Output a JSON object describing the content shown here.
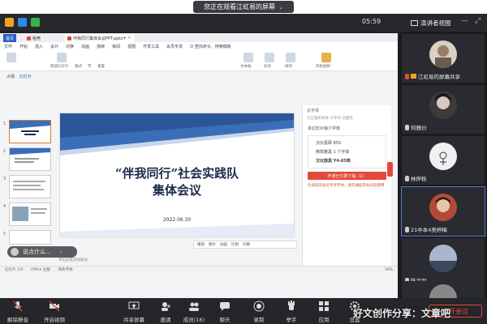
{
  "banner": {
    "viewing_text": "您正在观看江虹易的屏幕"
  },
  "meeting": {
    "time": "05:59",
    "speaker_view": "演讲者视图"
  },
  "wps": {
    "tabs": [
      "首页",
      "稻壳",
      "伴我同行集体会议PPT.pptx"
    ],
    "menus": [
      "文件",
      "开始",
      "插入",
      "设计",
      "切换",
      "动画",
      "放映",
      "审阅",
      "视图",
      "开发工具",
      "会员专享",
      "Q 查找命令、搜索模板"
    ],
    "toolbar_labels": [
      "新建幻灯片",
      "版式",
      "节",
      "重置",
      "文本框",
      "形状",
      "排列",
      "开始放映"
    ],
    "thumb_tabs": [
      "大纲",
      "幻灯片"
    ],
    "status": [
      "幻灯片 1/9",
      "Office 主题",
      "缺失字体"
    ],
    "notes_placeholder": "单击此处添加备注",
    "zoom": "58%",
    "mini_bar": [
      "播放",
      "图片",
      "动画",
      "比例",
      "切换"
    ]
  },
  "slide": {
    "title_line1": "“伴我同行”社会实践队",
    "title_line2": "集体会议",
    "date": "2022.06.30"
  },
  "side_panel": {
    "head": "云字体",
    "sub": "方正粗宋简体 大字体 已推荐",
    "section": "本幻灯片缺少字体",
    "lines": [
      "汉仪嘉颐 85S",
      "微软雅黑 1 个字体",
      "汉仪旗黑 Y4-85简"
    ],
    "button": "开通已付费下载（1）",
    "note": "包含稻壳会员专享字体，请开通稻壳会员后使用"
  },
  "speak_tip": "说点什么...",
  "participants": [
    {
      "name": "江虹易的屏幕共享",
      "muted": false,
      "bg": "#d9d0c6"
    },
    {
      "name": "何雅衍",
      "muted": true,
      "bg": "#3e3a3a"
    },
    {
      "name": "林烨栎",
      "muted": true,
      "bg": "#f0f0f0"
    },
    {
      "name": "21中本4吴婷梅",
      "muted": true,
      "bg": "#b24a3a"
    },
    {
      "name": "陈涂羽",
      "muted": true,
      "bg": "#6a7a95"
    },
    {
      "name": "",
      "muted": true,
      "bg": "#888"
    }
  ],
  "bottom": {
    "items": [
      {
        "label": "解除静音",
        "icon": "mic-off-icon"
      },
      {
        "label": "开启视频",
        "icon": "video-off-icon"
      },
      {
        "label": "共享屏幕",
        "icon": "share-screen-icon"
      },
      {
        "label": "邀请",
        "icon": "invite-icon"
      },
      {
        "label": "成员(16)",
        "icon": "members-icon"
      },
      {
        "label": "聊天",
        "icon": "chat-icon"
      },
      {
        "label": "录制",
        "icon": "record-icon"
      },
      {
        "label": "举手",
        "icon": "raise-hand-icon"
      },
      {
        "label": "应用",
        "icon": "apps-icon"
      },
      {
        "label": "设置",
        "icon": "settings-icon"
      }
    ],
    "leave": "离开会议"
  },
  "watermark": "好文创作分享：文章吧",
  "colors": {
    "accent": "#2b5ec5",
    "slide_blue": "#3a6fb8",
    "wps_red": "#e24a3b",
    "leave_red": "#e24a3b"
  }
}
